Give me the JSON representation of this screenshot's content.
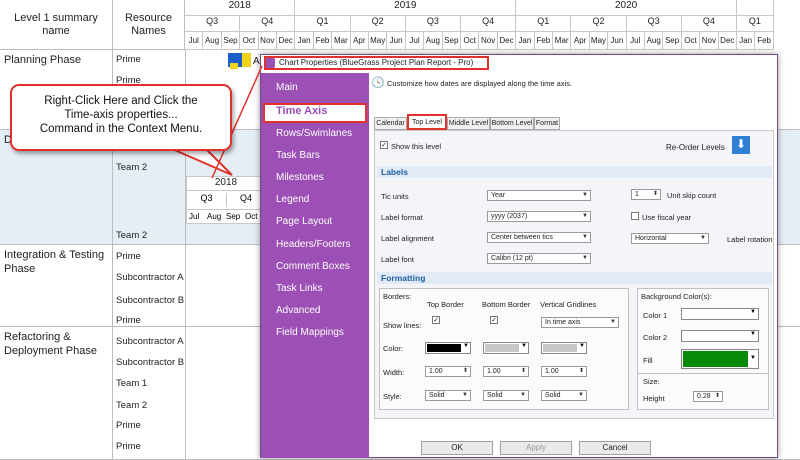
{
  "gantt": {
    "col_level1": "Level 1 summary name",
    "col_resource": "Resource Names",
    "years": [
      "2018",
      "2019",
      "2020"
    ],
    "quarters": [
      "Q3",
      "Q4",
      "Q1",
      "Q2",
      "Q3",
      "Q4",
      "Q1",
      "Q2",
      "Q3",
      "Q4",
      "Q1"
    ],
    "months": [
      "Jul",
      "Aug",
      "Sep",
      "Oct",
      "Nov",
      "Dec",
      "Jan",
      "Feb",
      "Mar",
      "Apr",
      "May",
      "Jun",
      "Jul",
      "Aug",
      "Sep",
      "Oct",
      "Nov",
      "Dec",
      "Jan",
      "Feb",
      "Mar",
      "Apr",
      "May",
      "Jun",
      "Jul",
      "Aug",
      "Sep",
      "Oct",
      "Nov",
      "Dec",
      "Jan",
      "Feb"
    ],
    "phases": [
      {
        "name": "Planning Phase",
        "resources": [
          "Prime",
          "Prime"
        ]
      },
      {
        "name": "D",
        "resources": [
          "Team 2",
          "Team 2"
        ]
      },
      {
        "name": "Integration & Testing Phase",
        "resources": [
          "Prime",
          "Subcontractor A",
          "Subcontractor B",
          "Prime"
        ]
      },
      {
        "name": "Refactoring & Deployment Phase",
        "resources": [
          "Subcontractor A",
          "Subcontractor B",
          "Team 1",
          "Team 2",
          "Prime",
          "Prime"
        ]
      }
    ],
    "mini_header": {
      "year": "2018",
      "quarters": [
        "Q3",
        "Q4"
      ],
      "months": [
        "Jul",
        "Aug",
        "Sep",
        "Oct"
      ]
    },
    "bar_letter": "A"
  },
  "callout": {
    "line1": "Right-Click Here and Click the",
    "line2": "Time-axis properties...",
    "line3": "Command in the Context Menu."
  },
  "dialog": {
    "title": "Chart Properties (BlueGrass Project Plan Report - Pro)",
    "description": "Customize how dates are displayed along the time axis.",
    "sidebar": [
      "Main",
      "Time Axis",
      "Rows/Swimlanes",
      "Task Bars",
      "Milestones",
      "Legend",
      "Page Layout",
      "Headers/Footers",
      "Comment Boxes",
      "Task Links",
      "Advanced",
      "Field Mappings"
    ],
    "tabs": [
      "Calendar",
      "Top Level",
      "Middle Level",
      "Bottom Level",
      "Format"
    ],
    "show_level": "Show this level",
    "reorder": "Re-Order Levels",
    "labels_section": "Labels",
    "tic_units_label": "Tic units",
    "tic_units_value": "Year",
    "unit_skip_value": "1",
    "unit_skip_label": "Unit skip count",
    "label_format_label": "Label format",
    "label_format_value": "yyyy (2037)",
    "fiscal_label": "Use fiscal year",
    "label_alignment_label": "Label alignment",
    "label_alignment_value": "Center between tics",
    "rotation_value": "Horizontal",
    "rotation_label": "Label rotation",
    "label_font_label": "Label font",
    "label_font_value": "Calibri (12 pt)",
    "formatting_section": "Formatting",
    "borders_label": "Borders:",
    "top_border": "Top Border",
    "bottom_border": "Bottom Border",
    "vertical_gridlines": "Vertical Gridlines",
    "show_lines": "Show lines:",
    "gridlines_value": "In time axis",
    "color_label": "Color:",
    "width_label": "Width:",
    "style_label": "Style:",
    "width_values": [
      "1.00",
      "1.00",
      "1.00"
    ],
    "style_values": [
      "Solid",
      "Solid",
      "Solid"
    ],
    "bg_colors_label": "Background Color(s):",
    "color1_label": "Color 1",
    "color2_label": "Color 2",
    "fill_label": "Fill",
    "size_label": "Size:",
    "height_label": "Height",
    "height_value": "0.28",
    "ok": "OK",
    "apply": "Apply",
    "cancel": "Cancel",
    "colors": {
      "sidebar": "#9c4fb4",
      "highlight": "#e0312b",
      "section": "#1f5fa6",
      "fill_green": "#0a8a0a",
      "top_border_color": "#000000",
      "bottom_border_color": "#c8c8c8"
    }
  }
}
